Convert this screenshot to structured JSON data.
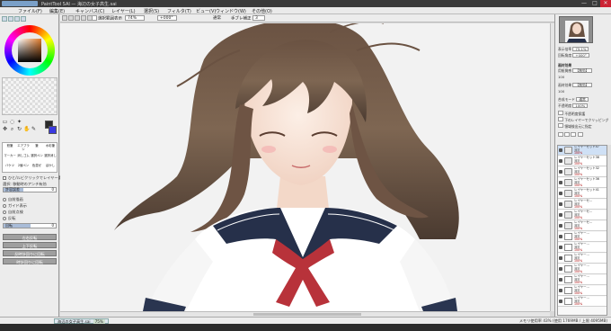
{
  "window": {
    "title": "PaintTool SAI — 海辺の女子高生.sai",
    "controls": [
      "—",
      "□",
      "✕"
    ]
  },
  "menu": [
    "ファイル(F)",
    "編集(E)",
    "キャンバス(C)",
    "レイヤー(L)",
    "選択(S)",
    "フィルタ(T)",
    "ビュー(V)",
    "ウィンドウ(W)",
    "その他(O)"
  ],
  "toolbar": {
    "selection_label": "選択範囲表示",
    "zoom": "74%",
    "rotation": "+000°",
    "mode_label": "通常",
    "stabilizer_label": "手ブレ補正",
    "stabilizer_value": "3"
  },
  "left_panel": {
    "brushes": [
      "鉛筆",
      "エアブラシ",
      "筆",
      "水彩筆",
      "マーカー",
      "消しゴム",
      "選択ペン",
      "選択消し",
      "バケツ",
      "2値ペン",
      "色混ぜ",
      "ぼかし"
    ],
    "options": [
      "ひと/ルビクリックでレイヤー選択",
      "選択: 移動時のアンチ有効",
      "自前描画",
      "ガイド表示",
      "自前点検",
      "反転"
    ],
    "slider1": {
      "label": "許容誤差",
      "value": "0"
    },
    "slider2": {
      "label": "回転",
      "value": "0"
    },
    "buttons": [
      "左右反転",
      "上下反転",
      "反時計回りに回転",
      "時計回りに回転"
    ],
    "swatch_colors": {
      "primary": "#2a2a2a",
      "secondary": "#3a3ae0"
    }
  },
  "right_panel": {
    "zoom_label": "表示倍率",
    "zoom_value": "75.1%",
    "angle_label": "回転角度",
    "angle_value": "+000°",
    "effects_title": "画材効果",
    "texture_label": "用紙質感",
    "texture_value": "【無効】",
    "texture_strength": "100",
    "effect_label": "画材効果",
    "effect_value": "【無効】",
    "effect_strength": "100",
    "blend_label": "合成モード",
    "blend_value": "通常",
    "opacity_label": "不透明度",
    "opacity_value": "100%",
    "checks": [
      "不透明度保護",
      "下のレイヤーでクリッピング",
      "領域検出元に指定"
    ],
    "layers": [
      {
        "name": "レイヤーセット47",
        "mode": "通常",
        "opacity": "100%",
        "folder": true,
        "selected": true
      },
      {
        "name": "レイヤーセット38",
        "mode": "通常",
        "opacity": "100%",
        "folder": true,
        "selected": false
      },
      {
        "name": "レイヤーセット32",
        "mode": "通常",
        "opacity": "100%",
        "folder": true,
        "selected": false
      },
      {
        "name": "レイヤーセット36",
        "mode": "通常",
        "opacity": "100%",
        "folder": true,
        "selected": false
      },
      {
        "name": "レイヤーセット41",
        "mode": "通常",
        "opacity": "100%",
        "folder": true,
        "selected": false
      },
      {
        "name": "レイヤーセ…",
        "mode": "通常",
        "opacity": "100%",
        "folder": true,
        "selected": false
      },
      {
        "name": "レイヤーセ…",
        "mode": "通常",
        "opacity": "100%",
        "folder": true,
        "selected": false
      },
      {
        "name": "レイヤーセ…",
        "mode": "通常",
        "opacity": "100%",
        "folder": true,
        "selected": false
      },
      {
        "name": "レイヤー…",
        "mode": "通常",
        "opacity": "100%",
        "folder": false,
        "selected": false
      },
      {
        "name": "レイヤー…",
        "mode": "通常",
        "opacity": "100%",
        "folder": false,
        "selected": false
      },
      {
        "name": "レイヤー…",
        "mode": "通常",
        "opacity": "100%",
        "folder": false,
        "selected": false
      },
      {
        "name": "レイヤー…",
        "mode": "通常",
        "opacity": "100%",
        "folder": false,
        "selected": false
      },
      {
        "name": "レイヤー…",
        "mode": "通常",
        "opacity": "100%",
        "folder": false,
        "selected": false
      },
      {
        "name": "レイヤー…",
        "mode": "通常",
        "opacity": "100%",
        "folder": false,
        "selected": false
      },
      {
        "name": "レイヤー…",
        "mode": "通常",
        "opacity": "100%",
        "folder": false,
        "selected": false
      }
    ]
  },
  "status": {
    "doc_tab": "海辺の女子高生.sai",
    "doc_zoom": "75%",
    "memory": "メモリ使用率 43% (使用 1769MB / 上限 4095MB)"
  }
}
